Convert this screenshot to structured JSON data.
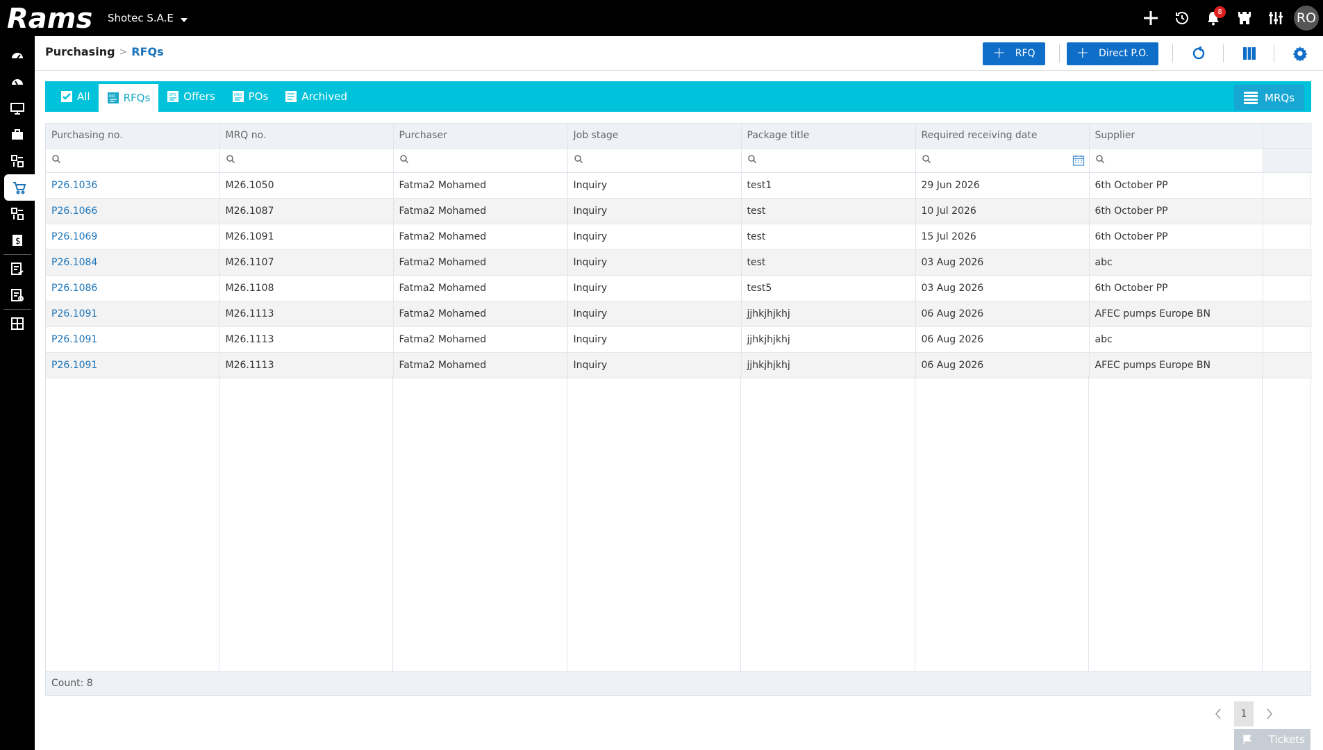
{
  "app": {
    "logo_text": "Rams",
    "company": "Shotec S.A.E",
    "notification_count": "8",
    "avatar_initials": "RO"
  },
  "breadcrumb": {
    "root": "Purchasing",
    "current": "RFQs"
  },
  "header_actions": {
    "rfq_label": "RFQ",
    "direct_po_label": "Direct P.O."
  },
  "tabs": [
    {
      "label": "All",
      "icon": "checkbox-icon"
    },
    {
      "label": "RFQs",
      "icon": "inq-doc-icon",
      "active": true
    },
    {
      "label": "Offers",
      "icon": "ofr-doc-icon"
    },
    {
      "label": "POs",
      "icon": "ord-doc-icon"
    },
    {
      "label": "Archived",
      "icon": "archive-doc-icon"
    }
  ],
  "mrqs_label": "MRQs",
  "grid": {
    "columns": [
      "Purchasing no.",
      "MRQ no.",
      "Purchaser",
      "Job stage",
      "Package title",
      "Required receiving date",
      "Supplier"
    ],
    "rows": [
      [
        "P26.1036",
        "M26.1050",
        "Fatma2 Mohamed",
        "Inquiry",
        "test1",
        "29 Jun 2026",
        "6th October PP"
      ],
      [
        "P26.1066",
        "M26.1087",
        "Fatma2 Mohamed",
        "Inquiry",
        "test",
        "10 Jul 2026",
        "6th October PP"
      ],
      [
        "P26.1069",
        "M26.1091",
        "Fatma2 Mohamed",
        "Inquiry",
        "test",
        "15 Jul 2026",
        "6th October PP"
      ],
      [
        "P26.1084",
        "M26.1107",
        "Fatma2 Mohamed",
        "Inquiry",
        "test",
        "03 Aug 2026",
        "abc"
      ],
      [
        "P26.1086",
        "M26.1108",
        "Fatma2 Mohamed",
        "Inquiry",
        "test5",
        "03 Aug 2026",
        "6th October PP"
      ],
      [
        "P26.1091",
        "M26.1113",
        "Fatma2 Mohamed",
        "Inquiry",
        "jjhkjhjkhj",
        "06 Aug 2026",
        "AFEC pumps Europe BN"
      ],
      [
        "P26.1091",
        "M26.1113",
        "Fatma2 Mohamed",
        "Inquiry",
        "jjhkjhjkhj",
        "06 Aug 2026",
        "abc"
      ],
      [
        "P26.1091",
        "M26.1113",
        "Fatma2 Mohamed",
        "Inquiry",
        "jjhkjhjkhj",
        "06 Aug 2026",
        "AFEC pumps Europe BN"
      ]
    ],
    "count_text": "Count: 8"
  },
  "pager": {
    "current_page": "1"
  },
  "tickets_label": "Tickets",
  "colors": {
    "topbar": "#000000",
    "accent_teal": "#00c2db",
    "primary_blue": "#0f6ec8",
    "link_blue": "#1a73b8"
  }
}
